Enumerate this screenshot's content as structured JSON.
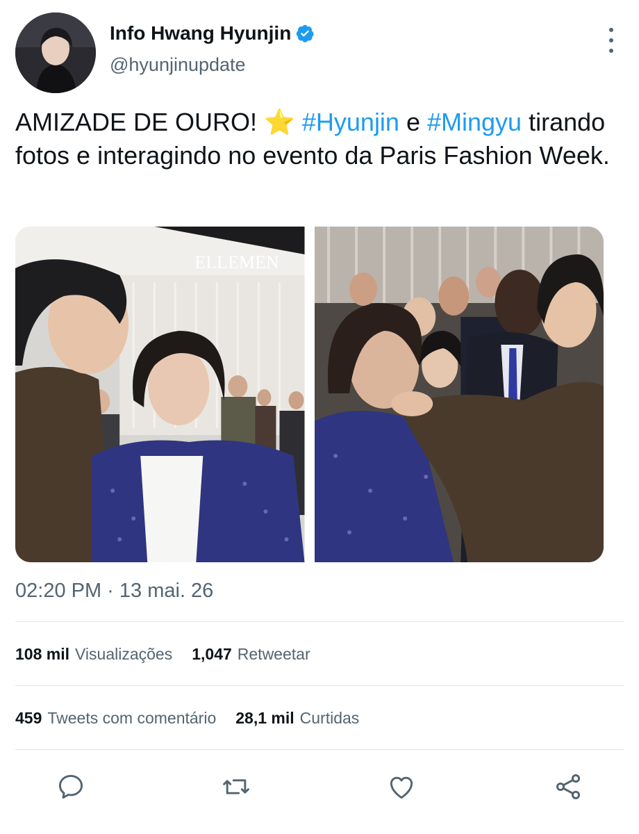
{
  "author": {
    "name": "Info Hwang Hyunjin",
    "handle": "@hyunjinupdate"
  },
  "tweet": {
    "text_parts": {
      "t1": "AMIZADE DE OURO! ",
      "emoji": "⭐",
      "t2": " ",
      "hashtag1": "#Hyunjin",
      "t3": " e ",
      "hashtag2": "#Mingyu",
      "t4": " tirando fotos e interagindo no evento da Paris Fashion Week."
    },
    "photo_watermark": "ELLEMEN"
  },
  "meta": {
    "timestamp": "02:20 PM · 13 mai. 26"
  },
  "stats": {
    "views_count": "108 mil",
    "views_label": "Visualizações",
    "retweets_count": "1,047",
    "retweets_label": "Retweetar",
    "quotes_count": "459",
    "quotes_label": "Tweets com comentário",
    "likes_count": "28,1 mil",
    "likes_label": "Curtidas"
  },
  "actions": {
    "reply_icon": "reply-icon",
    "retweet_icon": "retweet-icon",
    "like_icon": "heart-icon",
    "share_icon": "share-icon"
  },
  "colors": {
    "accent": "#1d9bf0",
    "secondary_text": "#536471",
    "primary_text": "#0f1419"
  }
}
